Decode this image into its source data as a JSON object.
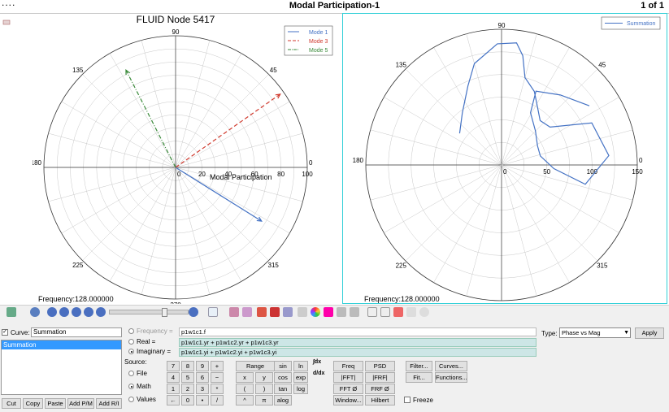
{
  "window": {
    "title": "Modal Participation-1",
    "page": "1 of 1",
    "menu_glyph": "...."
  },
  "left_plot": {
    "title": "FLUID Node 5417",
    "angle_labels": {
      "a0": "0",
      "a45": "45",
      "a90": "90",
      "a135": "135",
      "a180": "180",
      "a225": "225",
      "a270": "270",
      "a315": "315"
    },
    "radial_ticks": [
      "20",
      "40",
      "60",
      "80",
      "100"
    ],
    "axis_label": "Modal Participation",
    "legend": [
      "Mode 1",
      "Mode 3",
      "Mode 5"
    ],
    "frequency": "Frequency:128.000000"
  },
  "right_plot": {
    "angle_labels": {
      "a0": "0",
      "a45": "45",
      "a90": "90",
      "a135": "135",
      "a180": "180",
      "a225": "225",
      "a270": "270",
      "a315": "315"
    },
    "radial_ticks": [
      "50",
      "100",
      "150"
    ],
    "legend": [
      "Summation"
    ],
    "frequency": "Frequency:128.000000"
  },
  "chart_data": [
    {
      "type": "line",
      "title": "FLUID Node 5417",
      "coordinate": "polar",
      "r_range": [
        0,
        100
      ],
      "r_label": "Modal Participation",
      "legend_position": "top-right",
      "series": [
        {
          "name": "Mode 1",
          "color": "#4472c4",
          "style": "solid",
          "points": [
            {
              "angle": 0,
              "r": 0
            },
            {
              "angle": -32,
              "r": 77
            }
          ]
        },
        {
          "name": "Mode 3",
          "color": "#d03a2e",
          "style": "dashed",
          "points": [
            {
              "angle": 0,
              "r": 0
            },
            {
              "angle": 35,
              "r": 97
            }
          ]
        },
        {
          "name": "Mode 5",
          "color": "#3a8a3a",
          "style": "dashdot",
          "points": [
            {
              "angle": 0,
              "r": 0
            },
            {
              "angle": 117,
              "r": 83
            }
          ]
        }
      ]
    },
    {
      "type": "line",
      "coordinate": "polar",
      "r_range": [
        0,
        150
      ],
      "legend_position": "top-right",
      "series": [
        {
          "name": "Summation",
          "color": "#4472c4",
          "style": "solid",
          "points": [
            {
              "angle": 143,
              "r": 58
            },
            {
              "angle": 127,
              "r": 72
            },
            {
              "angle": 113,
              "r": 95
            },
            {
              "angle": 105,
              "r": 116
            },
            {
              "angle": 92,
              "r": 134
            },
            {
              "angle": 83,
              "r": 136
            },
            {
              "angle": 79,
              "r": 123
            },
            {
              "angle": 75,
              "r": 100
            },
            {
              "angle": 66,
              "r": 89
            },
            {
              "angle": 60,
              "r": 78
            },
            {
              "angle": 49,
              "r": 65
            },
            {
              "angle": 38,
              "r": 68
            },
            {
              "angle": 25,
              "r": 110
            },
            {
              "angle": 5,
              "r": 119
            },
            {
              "angle": -13,
              "r": 95
            },
            {
              "angle": -4,
              "r": 58
            },
            {
              "angle": 13,
              "r": 44
            },
            {
              "angle": 28,
              "r": 45
            },
            {
              "angle": 45,
              "r": 53
            },
            {
              "angle": 61,
              "r": 66
            },
            {
              "angle": 65,
              "r": 90
            },
            {
              "angle": 50,
              "r": 101
            },
            {
              "angle": 34,
              "r": 117
            }
          ]
        }
      ]
    }
  ],
  "curve_panel": {
    "curve_label": "Curve:",
    "curve_value": "Summation",
    "list_items": [
      "Summation"
    ],
    "buttons": [
      "Cut",
      "Copy",
      "Paste",
      "Add P/M",
      "Add R/I"
    ]
  },
  "expr": {
    "frequency_label": "Frequency =",
    "frequency_value": "p1w1c1.f",
    "real_label": "Real =",
    "real_value": "p1w1c1.yr + p1w1c2.yr + p1w1c3.yr",
    "imag_label": "Imaginary =",
    "imag_value": "p1w1c1.yi + p1w1c2.yi + p1w1c3.yi"
  },
  "source": {
    "label": "Source:",
    "options": [
      "File",
      "Math",
      "Values"
    ],
    "selected": "Math"
  },
  "keypad": [
    [
      "7",
      "8",
      "9",
      "+"
    ],
    [
      "4",
      "5",
      "6",
      "−"
    ],
    [
      "1",
      "2",
      "3",
      "*"
    ],
    [
      "←",
      "0",
      "•",
      "/"
    ]
  ],
  "ops": [
    [
      "Range",
      "sin",
      "ln"
    ],
    [
      "x",
      "y",
      "cos",
      "exp"
    ],
    [
      "(",
      ")",
      "tan",
      "log"
    ],
    [
      "^",
      "π",
      "alog"
    ]
  ],
  "ops_extra": [
    "∫dx",
    "d/dx",
    "Range"
  ],
  "funcs": [
    [
      "Freq",
      "PSD",
      "Filter...",
      "Curves..."
    ],
    [
      "|FFT|",
      "|FRF|",
      "Fit...",
      "Functions..."
    ],
    [
      "FFT Ø",
      "FRF Ø"
    ],
    [
      "Window...",
      "Hilbert"
    ]
  ],
  "freeze_label": "Freeze",
  "type": {
    "label": "Type:",
    "value": "Phase vs Mag"
  },
  "apply_label": "Apply"
}
